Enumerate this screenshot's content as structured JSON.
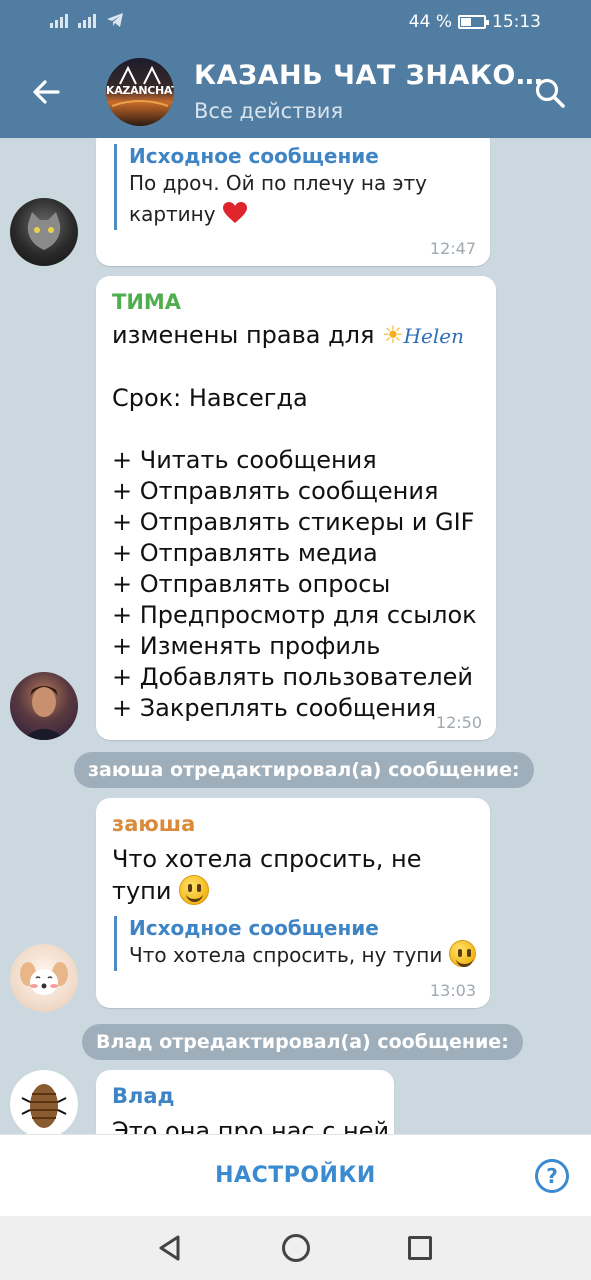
{
  "status": {
    "battery": "44 %",
    "time": "15:13"
  },
  "header": {
    "title": "КАЗАНЬ ЧАТ ЗНАКО…",
    "subtitle": "Все действия",
    "avatar_label": "KAZANCHAT"
  },
  "messages": [
    {
      "quote_header": "Исходное сообщение",
      "quote_text": "По дроч. Ой по плечу на эту картину",
      "time": "12:47"
    },
    {
      "sender": "ТИМА",
      "sender_color": "#4fae4e",
      "line1": "изменены права для",
      "mention": "Helen",
      "term": "Срок: Навсегда",
      "rights": [
        "+ Читать сообщения",
        "+ Отправлять сообщения",
        "+ Отправлять стикеры и GIF",
        "+ Отправлять медиа",
        "+ Отправлять опросы",
        "+ Предпросмотр для ссылок",
        "+ Изменять профиль",
        "+ Добавлять пользователей",
        "+ Закреплять сообщения"
      ],
      "time": "12:50"
    },
    {
      "service": "заюша отредактировал(а) сообщение:",
      "sender": "заюша",
      "sender_color": "#d98a3a",
      "text": "Что хотела спросить, не тупи",
      "quote_header": "Исходное сообщение",
      "quote_text": "Что хотела спросить, ну тупи",
      "time": "13:03"
    },
    {
      "service": "Влад отредактировал(а) сообщение:",
      "sender": "Влад",
      "sender_color": "#3f84c4",
      "text": "Это она про нас с ней"
    }
  ],
  "bottom": {
    "settings_label": "НАСТРОЙКИ",
    "help_label": "?"
  }
}
